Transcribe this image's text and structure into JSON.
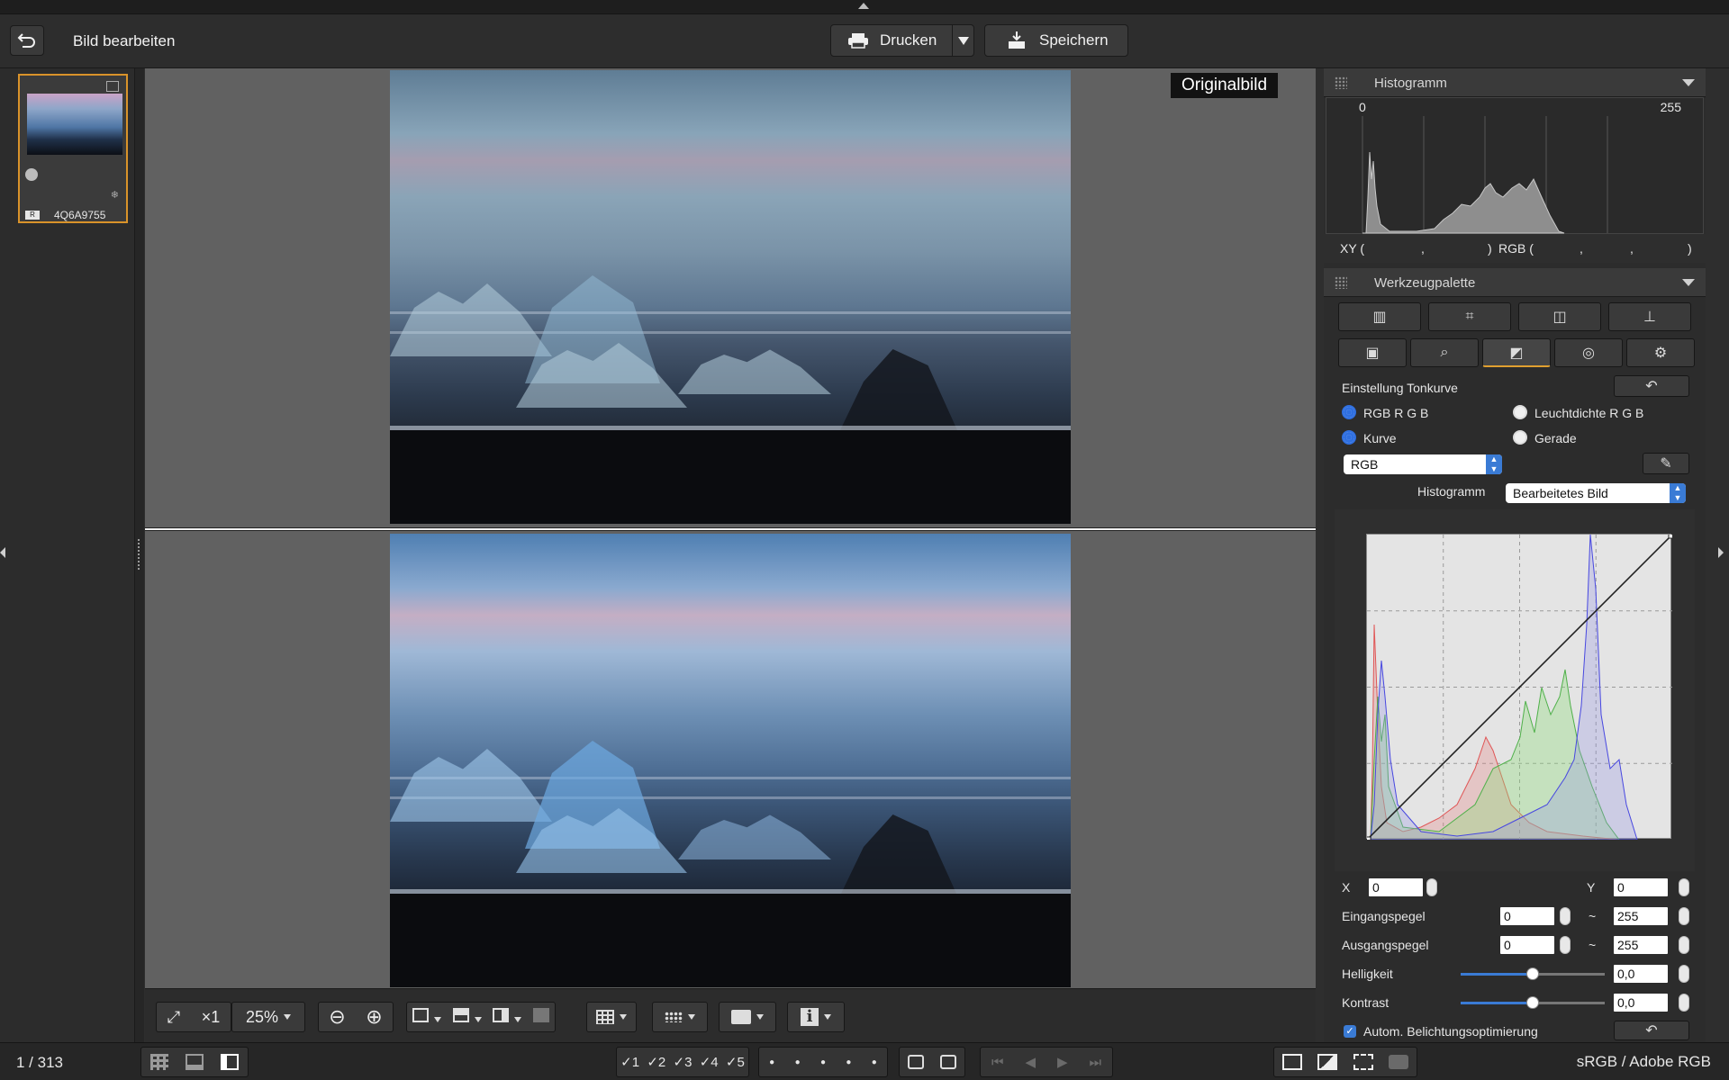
{
  "window": {
    "title": "Bild bearbeiten"
  },
  "toolbar": {
    "print_label": "Drucken",
    "save_label": "Speichern"
  },
  "filmstrip": {
    "thumb_label": "4Q6A9755",
    "thumb_badge": "R"
  },
  "viewer": {
    "original_label": "Originalbild"
  },
  "viewbar": {
    "zoom_fit": "⤢",
    "zoom_1x": "×1",
    "zoom_value": "25%",
    "zoom_out": "⊖",
    "zoom_in": "⊕",
    "info": "i"
  },
  "status": {
    "count": "1 / 313",
    "ratings": [
      "✓1",
      "✓2",
      "✓3",
      "✓4",
      "✓5"
    ],
    "colorspace": "sRGB / Adobe RGB"
  },
  "histogram_panel": {
    "title": "Histogramm",
    "min": "0",
    "max": "255",
    "xy_label": "XY (",
    "xy_comma": ",",
    "xy_close": ")",
    "rgb_label": "RGB (",
    "rgb_c1": ",",
    "rgb_c2": ",",
    "rgb_close": ")"
  },
  "tools_panel": {
    "title": "Werkzeugpalette",
    "section_title": "Einstellung Tonkurve",
    "mode_rgb": "RGB R G B",
    "mode_lum": "Leuchtdichte R G B",
    "curve_type": "Kurve",
    "curve_linear": "Gerade",
    "channel_select": "RGB",
    "histogram_label": "Histogramm",
    "histogram_select": "Bearbeitetes Bild",
    "x_label": "X",
    "x_value": "0",
    "y_label": "Y",
    "y_value": "0",
    "input_label": "Eingangspegel",
    "input_min": "0",
    "input_max": "255",
    "tilde1": "~",
    "output_label": "Ausgangspegel",
    "output_min": "0",
    "output_max": "255",
    "tilde2": "~",
    "brightness_label": "Helligkeit",
    "brightness_value": "0,0",
    "brightness_level": 0.5,
    "contrast_label": "Kontrast",
    "contrast_value": "0,0",
    "contrast_level": 0.5,
    "auto_label": "Autom. Belichtungsoptimierung",
    "auto_checked": true
  },
  "colors": {
    "accent": "#3a7bd5",
    "selection": "#d9932a"
  }
}
